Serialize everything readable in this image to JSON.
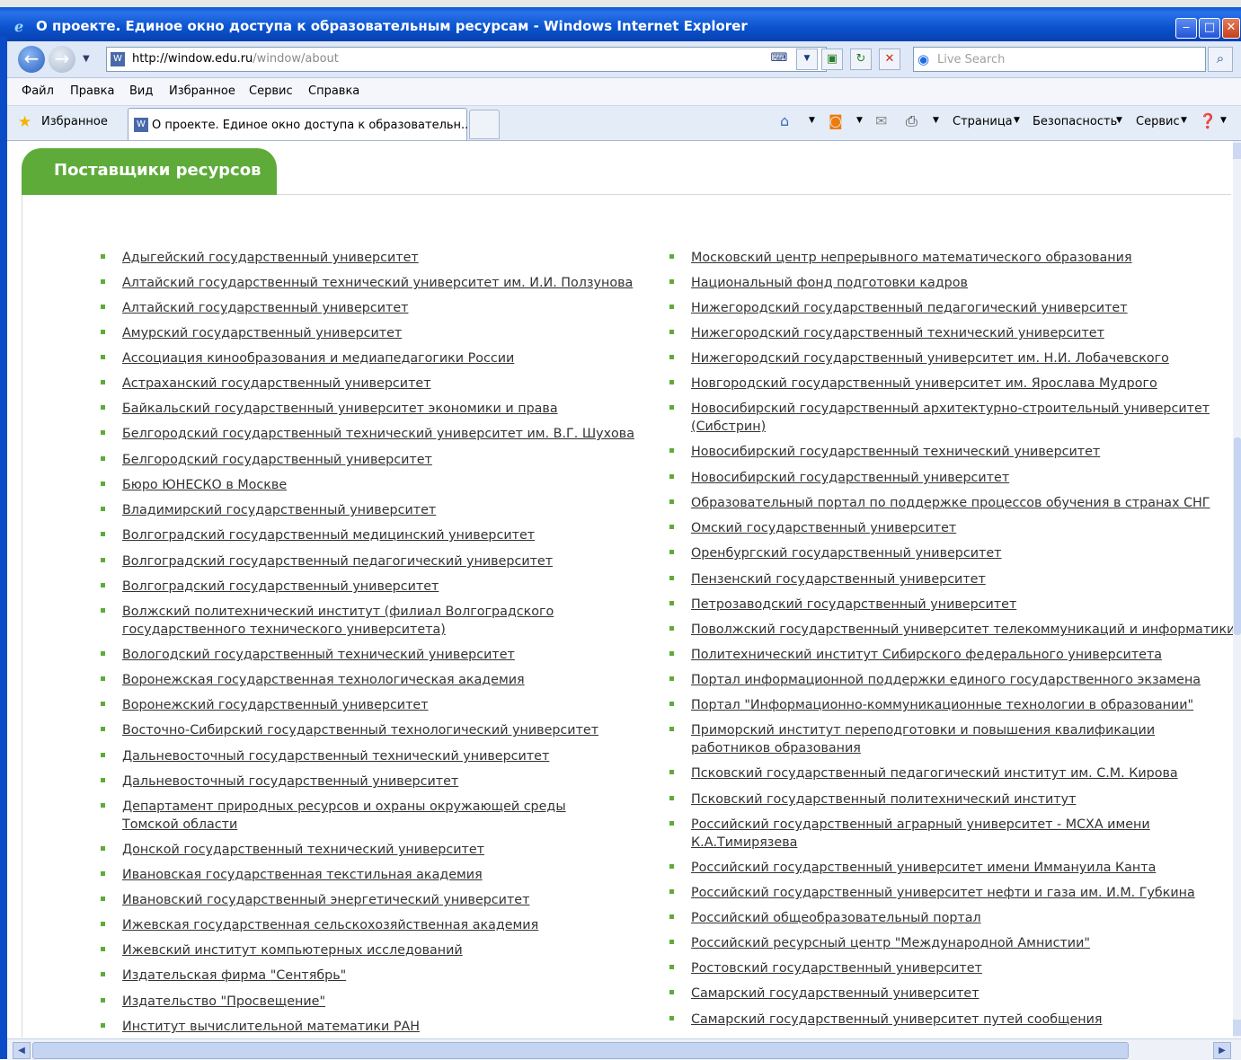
{
  "window": {
    "title": "О проекте. Единое окно доступа к образовательным ресурсам - Windows Internet Explorer",
    "minimize": "‒",
    "maximize": "□",
    "close": "✕"
  },
  "address_bar": {
    "url_host": "http://window.edu.ru",
    "url_path": "/window/about",
    "search_placeholder": "Live Search"
  },
  "menu": [
    "Файл",
    "Правка",
    "Вид",
    "Избранное",
    "Сервис",
    "Справка"
  ],
  "favorites_bar": {
    "favorites_label": "Избранное",
    "tab_title": "О проекте. Единое окно доступа к образовательн...",
    "commands": [
      "Страница",
      "Безопасность",
      "Сервис"
    ]
  },
  "panel": {
    "title": "Поставщики ресурсов"
  },
  "providers_left": [
    "Адыгейский государственный университет",
    "Алтайский государственный технический университет им. И.И. Ползунова",
    "Алтайский государственный университет",
    "Амурский государственный университет",
    "Ассоциация кинообразования и медиапедагогики России",
    "Астраханский государственный университет",
    "Байкальский государственный университет экономики и права",
    "Белгородский государственный технический университет им. В.Г. Шухова",
    "Белгородский государственный университет",
    "Бюро ЮНЕСКО в Москве",
    "Владимирский государственный университет",
    "Волгоградский государственный медицинский университет",
    "Волгоградский государственный педагогический университет",
    "Волгоградский государственный университет",
    "Волжский политехнический институт (филиал Волгоградского государственного технического университета)",
    "Вологодский государственный технический университет",
    "Воронежская государственная технологическая академия",
    "Воронежский государственный университет",
    "Восточно-Сибирский государственный технологический университет",
    "Дальневосточный государственный технический университет",
    "Дальневосточный государственный университет",
    "Департамент природных ресурсов и охраны окружающей среды Томской области",
    "Донской государственный технический университет",
    "Ивановская государственная текстильная академия",
    "Ивановский государственный энергетический университет",
    "Ижевская государственная сельскохозяйственная академия",
    "Ижевский институт компьютерных исследований",
    "Издательская фирма \"Сентябрь\"",
    "Издательство \"Просвещение\"",
    "Институт вычислительной математики РАН"
  ],
  "providers_right": [
    "Московский центр непрерывного математического образования",
    "Национальный фонд подготовки кадров",
    "Нижегородский государственный педагогический университет",
    "Нижегородский государственный технический университет",
    "Нижегородский государственный университет им. Н.И. Лобачевского",
    "Новгородский государственный университет им. Ярослава Мудрого",
    "Новосибирский государственный архитектурно-строительный университет (Сибстрин)",
    "Новосибирский государственный технический университет",
    "Новосибирский государственный университет",
    "Образовательный портал по поддержке процессов обучения в странах СНГ",
    "Омский государственный университет",
    "Оренбургский государственный университет",
    "Пензенский государственный университет",
    "Петрозаводский государственный университет",
    "Поволжский государственный университет телекоммуникаций и информатики",
    "Политехнический институт Сибирского федерального университета",
    "Портал информационной поддержки единого государственного экзамена",
    "Портал \"Информационно-коммуникационные технологии в образовании\"",
    "Приморский институт переподготовки и повышения квалификации работников образования",
    "Псковский государственный педагогический институт им. С.М. Кирова",
    "Псковский государственный политехнический институт",
    "Российский государственный аграрный университет - МСХА имени К.А.Тимирязева",
    "Российский государственный университет имени Иммануила Канта",
    "Российский государственный университет нефти и газа им. И.М. Губкина",
    "Российский общеобразовательный портал",
    "Российский ресурсный центр \"Международной Амнистии\"",
    "Ростовский государственный университет",
    "Самарский государственный университет",
    "Самарский государственный университет путей сообщения"
  ],
  "colors": {
    "accent_green": "#5eab3a",
    "link": "#333333",
    "titlebar_blue": "#0a58d6"
  },
  "icons": [
    "back-arrow-icon",
    "forward-arrow-icon",
    "favorites-star-icon",
    "home-icon",
    "rss-feed-icon",
    "print-icon",
    "help-icon",
    "search-icon"
  ]
}
